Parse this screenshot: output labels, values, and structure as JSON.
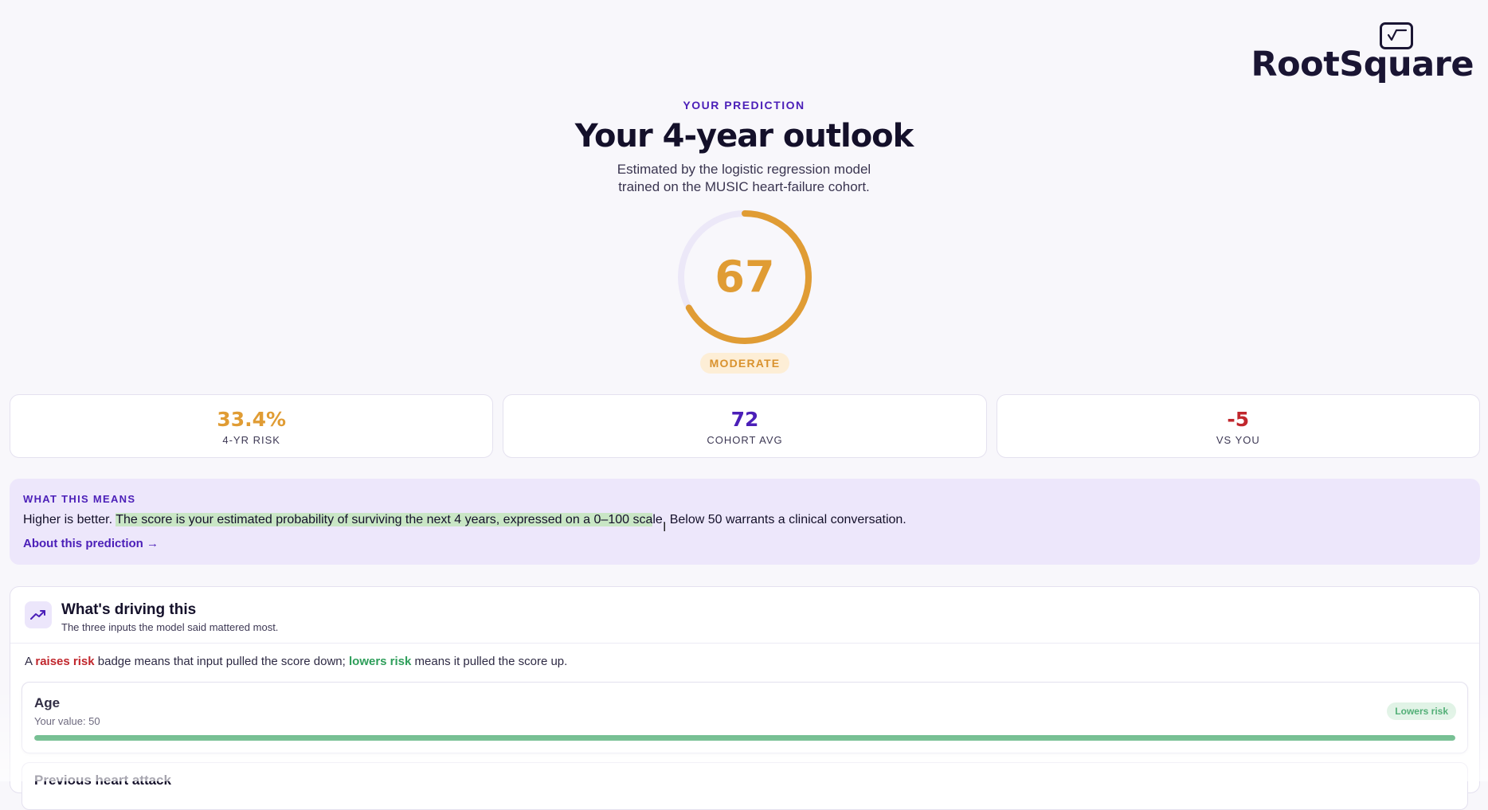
{
  "brand": {
    "name": "RootSquare",
    "icon": "chart-window-icon"
  },
  "hero": {
    "eyebrow": "YOUR PREDICTION",
    "title": "Your 4-year outlook",
    "subtitle_line1": "Estimated by the logistic regression model",
    "subtitle_line2": "trained on the MUSIC heart-failure cohort."
  },
  "gauge": {
    "score": "67",
    "max": 100,
    "fraction": 0.67,
    "level": "MODERATE",
    "color": "#e09c34",
    "track_color": "#ece8f8"
  },
  "stats": [
    {
      "value": "33.4%",
      "label": "4-YR RISK",
      "color": "#e09c34"
    },
    {
      "value": "72",
      "label": "COHORT AVG",
      "color": "#4b1fb8"
    },
    {
      "value": "-5",
      "label": "VS YOU",
      "color": "#c1272d"
    }
  ],
  "means": {
    "eyebrow": "WHAT THIS MEANS",
    "text_lead": "Higher is better. ",
    "text_highlight": "The score is your estimated probability of surviving the next 4 years, expressed on a 0–100 sca",
    "text_tail": "le. Below 50 warrants a clinical conversation.",
    "link": "About this prediction →"
  },
  "drivers": {
    "icon": "trending-up-icon",
    "title": "What's driving this",
    "subtitle": "The three inputs the model said mattered most.",
    "legend": {
      "p1": "A ",
      "raises": "raises risk",
      "p2": " badge means that input pulled the score down; ",
      "lowers": "lowers risk",
      "p3": " means it pulled the score up."
    },
    "factors": [
      {
        "name": "Age",
        "value": "Your value: 50",
        "badge": "Lowers risk",
        "fill": 1.0
      },
      {
        "name": "Previous heart attack"
      }
    ]
  },
  "colors": {
    "accent": "#4b1fb8",
    "success": "#2e9e5a",
    "danger": "#c1272d",
    "warning": "#e09c34"
  }
}
